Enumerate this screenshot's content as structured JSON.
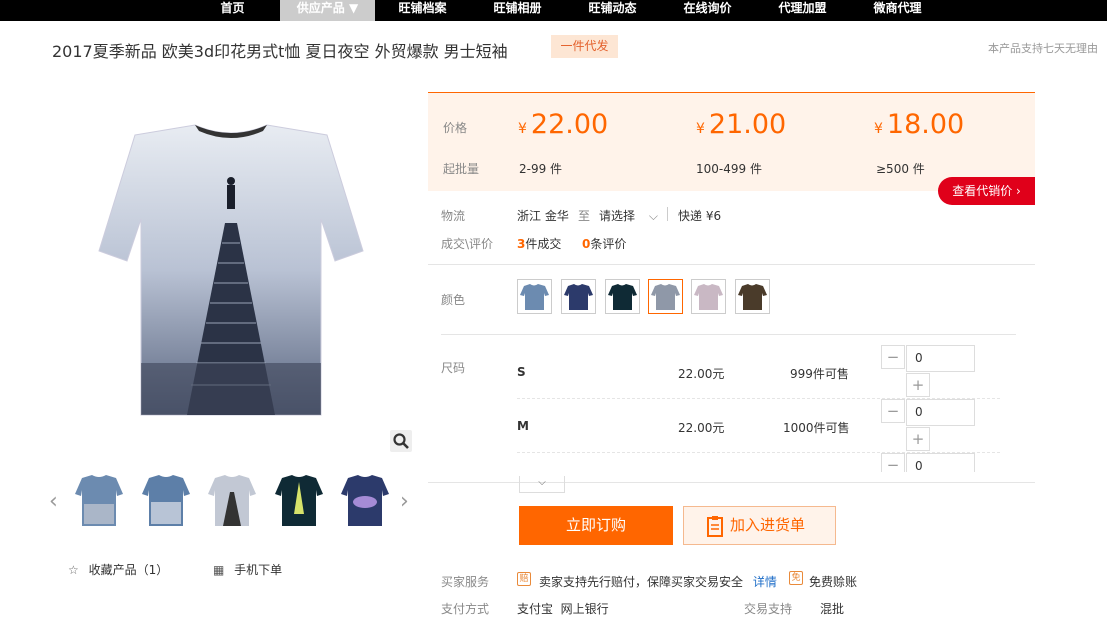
{
  "nav": [
    {
      "label": "首页"
    },
    {
      "label": "供应产品 ▼"
    },
    {
      "label": "旺铺档案"
    },
    {
      "label": "旺铺相册"
    },
    {
      "label": "旺铺动态"
    },
    {
      "label": "在线询价"
    },
    {
      "label": "代理加盟"
    },
    {
      "label": "微商代理"
    }
  ],
  "product": {
    "title": "2017夏季新品 欧美3d印花男式t恤 夏日夜空 外贸爆款 男士短袖",
    "badge": "一件代发",
    "return_note": "本产品支持七天无理由"
  },
  "gallery": {
    "left_arrow": "‹",
    "right_arrow": "›",
    "zoom_icon": "search-icon"
  },
  "actions": {
    "favorite": "收藏产品（1）",
    "mobile": "手机下单"
  },
  "pricing": {
    "price_label": "价格",
    "moq_label": "起批量",
    "currency": "¥",
    "tiers": [
      {
        "price": "22.00",
        "qty": "2-99 件"
      },
      {
        "price": "21.00",
        "qty": "100-499 件"
      },
      {
        "price": "18.00",
        "qty": "≥500 件"
      }
    ],
    "agent_button": "查看代销价 ›"
  },
  "logistics": {
    "label": "物流",
    "origin": "浙江 金华",
    "to": "至",
    "select": "请选择",
    "chevron": "⌵",
    "express": "快递 ¥6"
  },
  "deals": {
    "label": "成交\\评价",
    "sold_count": "3",
    "sold_text": "件成交",
    "review_count": "0",
    "review_text": "条评价"
  },
  "color": {
    "label": "颜色",
    "swatch_colors": [
      "#6c8bb0",
      "#2c3a6b",
      "#0f2a35",
      "#8f98a8",
      "#c9b8c4",
      "#4a3b2a"
    ]
  },
  "sizes": {
    "label": "尺码",
    "items": [
      {
        "name": "S",
        "price": "22.00元",
        "stock": "999件可售",
        "qty": "0"
      },
      {
        "name": "M",
        "price": "22.00元",
        "stock": "1000件可售",
        "qty": "0"
      },
      {
        "qty": "0"
      }
    ],
    "minus": "−",
    "plus": "+",
    "expand": "⌵"
  },
  "buttons": {
    "buy": "立即订购",
    "cart": "加入进货单"
  },
  "service": {
    "label": "买家服务",
    "icon1": "赔",
    "text1": "卖家支持先行赔付，保障买家交易安全",
    "detail": "详情",
    "icon2": "免",
    "text2": "免费赊账"
  },
  "payment": {
    "label": "支付方式",
    "value": "支付宝  网上银行",
    "trade_label": "交易支持",
    "trade_value": "混批"
  },
  "colors": {
    "accent": "#ff6600",
    "red": "#e0001a",
    "price_bg": "#fff3ea"
  }
}
